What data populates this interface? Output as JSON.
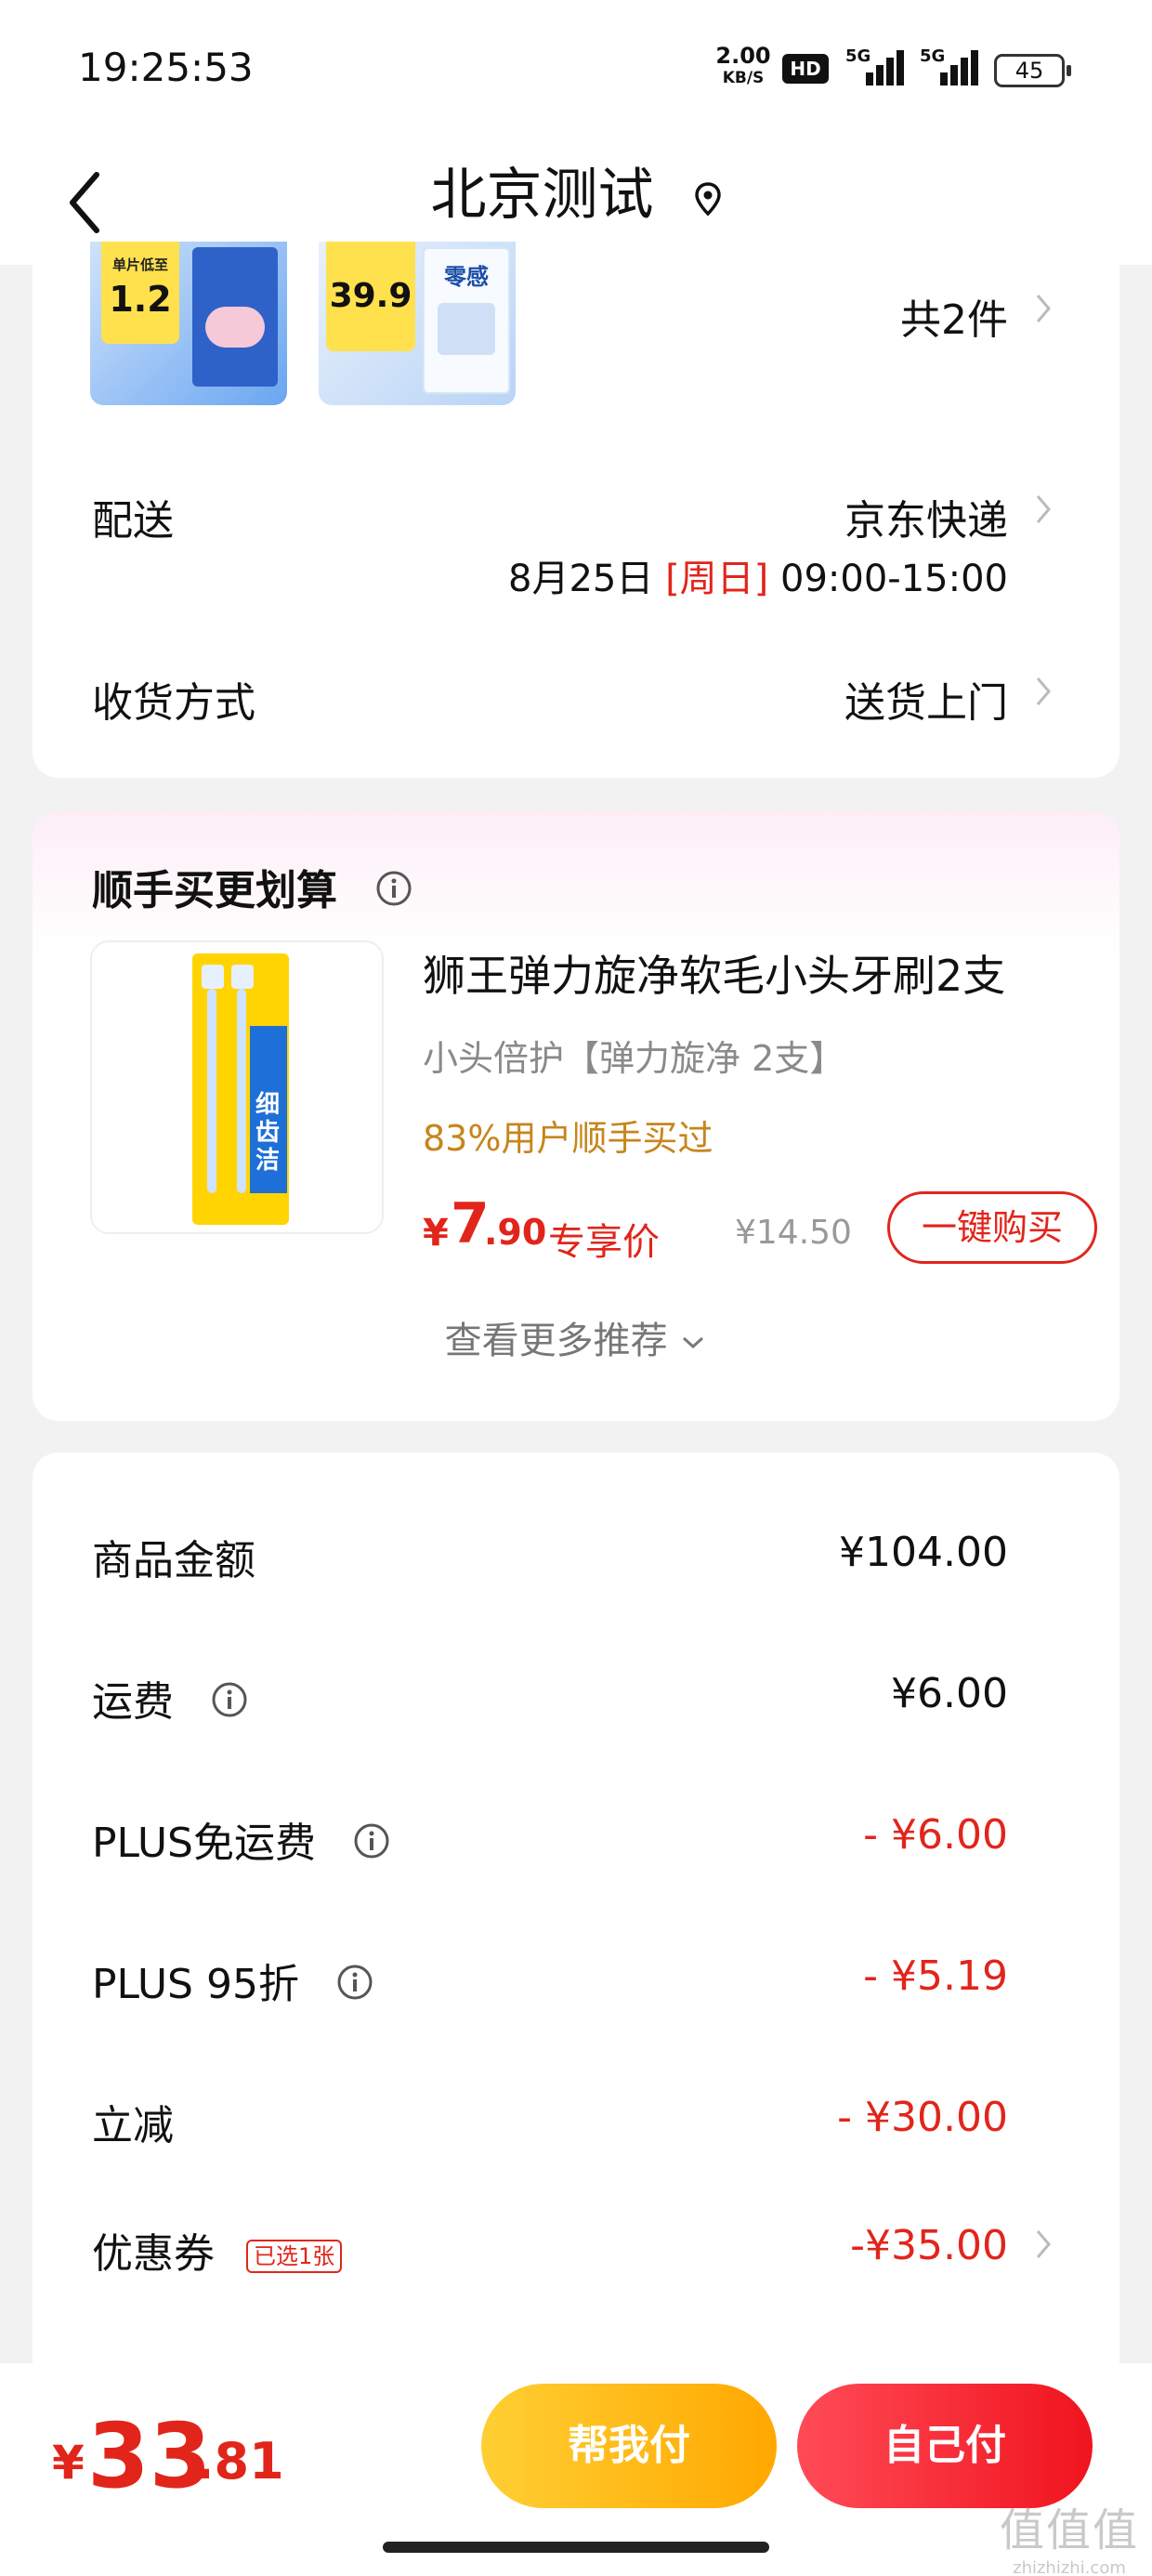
{
  "status_bar": {
    "time": "19:25:53",
    "net_speed_value": "2.00",
    "net_speed_unit": "KB/S",
    "hd_label": "HD",
    "signal1_label": "5G",
    "signal2_label": "5G",
    "battery": "45"
  },
  "nav": {
    "title": "北京测试"
  },
  "order": {
    "item_count": "共2件",
    "thumb1_text": "1.2",
    "thumb1_caption": "单片低至",
    "thumb2_text": "39.9",
    "thumb2_caption": "零感",
    "delivery_label": "配送",
    "delivery_value": "京东快递",
    "delivery_date": "8月25日",
    "delivery_day": "[周日]",
    "delivery_time": "09:00-15:00",
    "receive_label": "收货方式",
    "receive_value": "送货上门"
  },
  "recommend": {
    "title": "顺手买更划算",
    "product_name": "狮王弹力旋净软毛小头牙刷2支",
    "product_sub": "小头倍护【弹力旋净 2支】",
    "product_stat": "83%用户顺手买过",
    "price_symbol": "¥",
    "price_int": "7",
    "price_dec": ".90",
    "price_tag": "专享价",
    "original_price": "¥14.50",
    "buy_label": "一键购买",
    "more_label": "查看更多推荐",
    "package_text": "细齿洁"
  },
  "summary": {
    "items": [
      {
        "label": "商品金额",
        "value": "¥104.00",
        "has_info": false,
        "negative": false
      },
      {
        "label": "运费",
        "value": "¥6.00",
        "has_info": true,
        "negative": false
      },
      {
        "label": "PLUS免运费",
        "value": "- ¥6.00",
        "has_info": true,
        "negative": true
      },
      {
        "label": "PLUS 95折",
        "value": "- ¥5.19",
        "has_info": true,
        "negative": true
      },
      {
        "label": "立减",
        "value": "- ¥30.00",
        "has_info": false,
        "negative": true
      },
      {
        "label": "优惠券",
        "value": "-¥35.00",
        "has_info": false,
        "negative": true
      }
    ],
    "coupon_badge": "已选1张"
  },
  "bottom": {
    "total_symbol": "¥",
    "total_int": "33",
    "total_dec": ".81",
    "help_pay_label": "帮我付",
    "self_pay_label": "自己付"
  },
  "watermark": {
    "big": "值值值",
    "small": "zhizhizhi.com"
  },
  "colors": {
    "accent": "#e1251b",
    "help_btn": "#ffb300",
    "stat": "#c7851c"
  }
}
